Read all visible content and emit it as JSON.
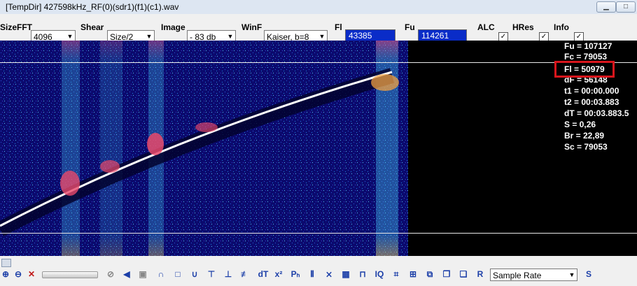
{
  "window": {
    "title": "[TempDir] 427598kHz_RF(0)(sdr1)(f1)(c1).wav"
  },
  "toolbar": {
    "sizefft_label": "SizeFFT",
    "sizefft_value": "4096",
    "shear_label": "Shear",
    "shear_value": "Size/2",
    "image_label": "Image",
    "image_value": "- 83 db",
    "winf_label": "WinF",
    "winf_value": "Kaiser, b=8",
    "fl_label": "Fl",
    "fl_value": "43385",
    "fu_label": "Fu",
    "fu_value": "114261",
    "alc_label": "ALC",
    "alc_checked": true,
    "hres_label": "HRes",
    "hres_checked": true,
    "info_label": "Info",
    "info_checked": true
  },
  "info_lines": [
    "Fu = 107127",
    "Fc = 79053",
    "Fl = 50979",
    "dF = 56148",
    "t1 = 00:00.000",
    "t2 = 00:03.883",
    "dT = 00:03.883.5",
    "S = 0,26",
    "Br = 22,89",
    "Sc = 79053"
  ],
  "bottom_toolbar": {
    "sample_rate_value": "Sample Rate",
    "buttons": [
      "zoom-in-icon",
      "zoom-out-icon",
      "close-x-icon",
      "circle-slash-icon",
      "speaker-icon",
      "stop-icon",
      "curve-up-icon",
      "square-icon",
      "curve-down-icon",
      "mark-icon",
      "mark-down-icon",
      "mark-double-icon",
      "dt-icon",
      "x-power-icon",
      "ph-icon",
      "bars-icon",
      "cross-icon",
      "grid-icon",
      "iq-stack-icon",
      "iq-icon",
      "filter-icon",
      "comb-icon",
      "screen-icon",
      "copy-icon",
      "r-icon",
      "s-icon"
    ]
  },
  "colors": {
    "freq_box_bg": "#0a2cc8",
    "spectro_bg": "#0b0a6e",
    "highlight": "#d8151c"
  }
}
